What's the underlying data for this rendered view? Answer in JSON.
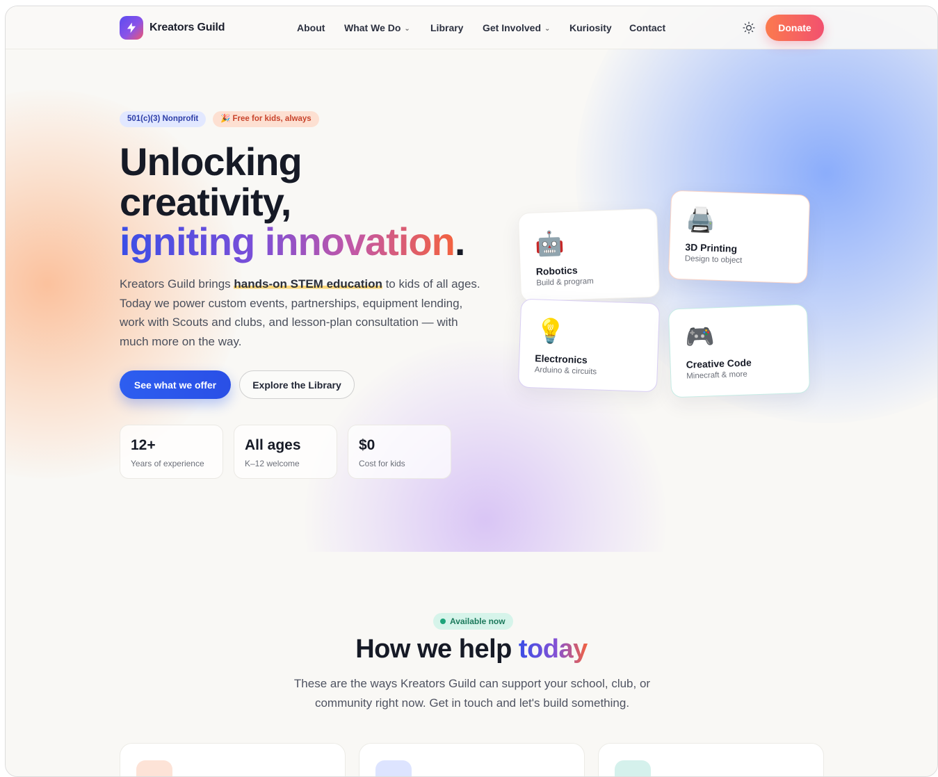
{
  "nav": {
    "brand": "Kreators Guild",
    "links": [
      "About",
      "What We Do",
      "Library",
      "Get Involved",
      "Kuriosity",
      "Contact"
    ],
    "donate_label": "Donate"
  },
  "hero": {
    "badges": [
      "501(c)(3) Nonprofit",
      "🎉 Free for kids, always"
    ],
    "headline": {
      "line1": "Unlocking",
      "line2": "creativity,",
      "line3": "igniting innovation",
      "period": "."
    },
    "lead": {
      "before": "Kreators Guild brings ",
      "highlight": "hands-on STEM education",
      "after": " to kids of all ages. Today we power custom events, partnerships, equipment lending, work with Scouts and clubs, and lesson-plan consultation — with much more on the way."
    },
    "primary_cta": "See what we offer",
    "secondary_cta": "Explore the Library",
    "stats": [
      {
        "value": "12+",
        "label": "Years of experience"
      },
      {
        "value": "All ages",
        "label": "K–12 welcome"
      },
      {
        "value": "$0",
        "label": "Cost for kids"
      }
    ],
    "tiles": [
      {
        "emoji": "🤖",
        "title": "Robotics",
        "subtitle": "Build & program"
      },
      {
        "emoji": "🖨️",
        "title": "3D Printing",
        "subtitle": "Design to object"
      },
      {
        "emoji": "💡",
        "title": "Electronics",
        "subtitle": "Arduino & circuits"
      },
      {
        "emoji": "🎮",
        "title": "Creative Code",
        "subtitle": "Minecraft & more"
      }
    ]
  },
  "help": {
    "badge": "Available now",
    "title_plain": "How we help ",
    "title_accent": "today",
    "subtitle": "These are the ways Kreators Guild can support your school, club, or community right now. Get in touch and let's build something."
  },
  "colors": {
    "primary": "#2d5ef0",
    "donate_start": "#fb7a4e",
    "donate_end": "#f2516f",
    "background": "#f9f8f5"
  }
}
